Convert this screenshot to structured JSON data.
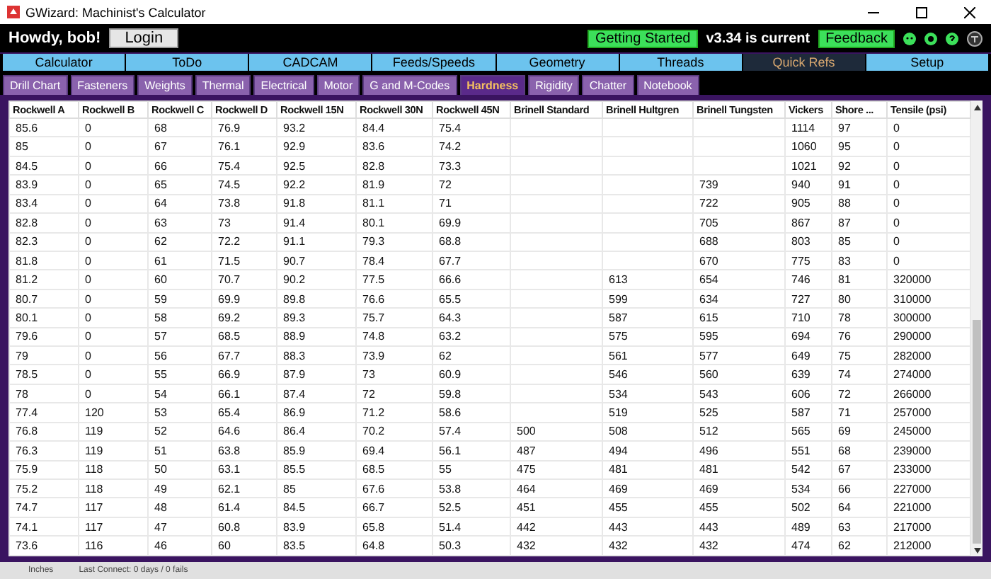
{
  "window": {
    "title": "GWizard: Machinist's Calculator"
  },
  "header": {
    "greeting": "Howdy, bob!",
    "login": "Login",
    "getting_started": "Getting Started",
    "version": "v3.34 is current",
    "feedback": "Feedback"
  },
  "main_tabs": [
    {
      "label": "Calculator",
      "selected": false
    },
    {
      "label": "ToDo",
      "selected": false
    },
    {
      "label": "CADCAM",
      "selected": false
    },
    {
      "label": "Feeds/Speeds",
      "selected": false
    },
    {
      "label": "Geometry",
      "selected": false
    },
    {
      "label": "Threads",
      "selected": false
    },
    {
      "label": "Quick Refs",
      "selected": true
    },
    {
      "label": "Setup",
      "selected": false
    }
  ],
  "sub_tabs": [
    {
      "label": "Drill Chart",
      "selected": false
    },
    {
      "label": "Fasteners",
      "selected": false
    },
    {
      "label": "Weights",
      "selected": false
    },
    {
      "label": "Thermal",
      "selected": false
    },
    {
      "label": "Electrical",
      "selected": false
    },
    {
      "label": "Motor",
      "selected": false
    },
    {
      "label": "G and M-Codes",
      "selected": false
    },
    {
      "label": "Hardness",
      "selected": true
    },
    {
      "label": "Rigidity",
      "selected": false
    },
    {
      "label": "Chatter",
      "selected": false
    },
    {
      "label": "Notebook",
      "selected": false
    }
  ],
  "table": {
    "columns": [
      "Rockwell A",
      "Rockwell B",
      "Rockwell C",
      "Rockwell D",
      "Rockwell 15N",
      "Rockwell 30N",
      "Rockwell 45N",
      "Brinell Standard",
      "Brinell Hultgren",
      "Brinell Tungsten",
      "Vickers",
      "Shore ...",
      "Tensile (psi)"
    ],
    "rows": [
      [
        "85.6",
        "0",
        "68",
        "76.9",
        "93.2",
        "84.4",
        "75.4",
        null,
        null,
        null,
        "1114",
        "97",
        "0"
      ],
      [
        "85",
        "0",
        "67",
        "76.1",
        "92.9",
        "83.6",
        "74.2",
        null,
        null,
        null,
        "1060",
        "95",
        "0"
      ],
      [
        "84.5",
        "0",
        "66",
        "75.4",
        "92.5",
        "82.8",
        "73.3",
        null,
        null,
        null,
        "1021",
        "92",
        "0"
      ],
      [
        "83.9",
        "0",
        "65",
        "74.5",
        "92.2",
        "81.9",
        "72",
        null,
        null,
        "739",
        "940",
        "91",
        "0"
      ],
      [
        "83.4",
        "0",
        "64",
        "73.8",
        "91.8",
        "81.1",
        "71",
        null,
        null,
        "722",
        "905",
        "88",
        "0"
      ],
      [
        "82.8",
        "0",
        "63",
        "73",
        "91.4",
        "80.1",
        "69.9",
        null,
        null,
        "705",
        "867",
        "87",
        "0"
      ],
      [
        "82.3",
        "0",
        "62",
        "72.2",
        "91.1",
        "79.3",
        "68.8",
        null,
        null,
        "688",
        "803",
        "85",
        "0"
      ],
      [
        "81.8",
        "0",
        "61",
        "71.5",
        "90.7",
        "78.4",
        "67.7",
        null,
        null,
        "670",
        "775",
        "83",
        "0"
      ],
      [
        "81.2",
        "0",
        "60",
        "70.7",
        "90.2",
        "77.5",
        "66.6",
        null,
        "613",
        "654",
        "746",
        "81",
        "320000"
      ],
      [
        "80.7",
        "0",
        "59",
        "69.9",
        "89.8",
        "76.6",
        "65.5",
        null,
        "599",
        "634",
        "727",
        "80",
        "310000"
      ],
      [
        "80.1",
        "0",
        "58",
        "69.2",
        "89.3",
        "75.7",
        "64.3",
        null,
        "587",
        "615",
        "710",
        "78",
        "300000"
      ],
      [
        "79.6",
        "0",
        "57",
        "68.5",
        "88.9",
        "74.8",
        "63.2",
        null,
        "575",
        "595",
        "694",
        "76",
        "290000"
      ],
      [
        "79",
        "0",
        "56",
        "67.7",
        "88.3",
        "73.9",
        "62",
        null,
        "561",
        "577",
        "649",
        "75",
        "282000"
      ],
      [
        "78.5",
        "0",
        "55",
        "66.9",
        "87.9",
        "73",
        "60.9",
        null,
        "546",
        "560",
        "639",
        "74",
        "274000"
      ],
      [
        "78",
        "0",
        "54",
        "66.1",
        "87.4",
        "72",
        "59.8",
        null,
        "534",
        "543",
        "606",
        "72",
        "266000"
      ],
      [
        "77.4",
        "120",
        "53",
        "65.4",
        "86.9",
        "71.2",
        "58.6",
        null,
        "519",
        "525",
        "587",
        "71",
        "257000"
      ],
      [
        "76.8",
        "119",
        "52",
        "64.6",
        "86.4",
        "70.2",
        "57.4",
        "500",
        "508",
        "512",
        "565",
        "69",
        "245000"
      ],
      [
        "76.3",
        "119",
        "51",
        "63.8",
        "85.9",
        "69.4",
        "56.1",
        "487",
        "494",
        "496",
        "551",
        "68",
        "239000"
      ],
      [
        "75.9",
        "118",
        "50",
        "63.1",
        "85.5",
        "68.5",
        "55",
        "475",
        "481",
        "481",
        "542",
        "67",
        "233000"
      ],
      [
        "75.2",
        "118",
        "49",
        "62.1",
        "85",
        "67.6",
        "53.8",
        "464",
        "469",
        "469",
        "534",
        "66",
        "227000"
      ],
      [
        "74.7",
        "117",
        "48",
        "61.4",
        "84.5",
        "66.7",
        "52.5",
        "451",
        "455",
        "455",
        "502",
        "64",
        "221000"
      ],
      [
        "74.1",
        "117",
        "47",
        "60.8",
        "83.9",
        "65.8",
        "51.4",
        "442",
        "443",
        "443",
        "489",
        "63",
        "217000"
      ],
      [
        "73.6",
        "116",
        "46",
        "60",
        "83.5",
        "64.8",
        "50.3",
        "432",
        "432",
        "432",
        "474",
        "62",
        "212000"
      ]
    ]
  },
  "status_bar": {
    "units": "Inches",
    "last_connect": "Last Connect: 0 days / 0 fails"
  }
}
